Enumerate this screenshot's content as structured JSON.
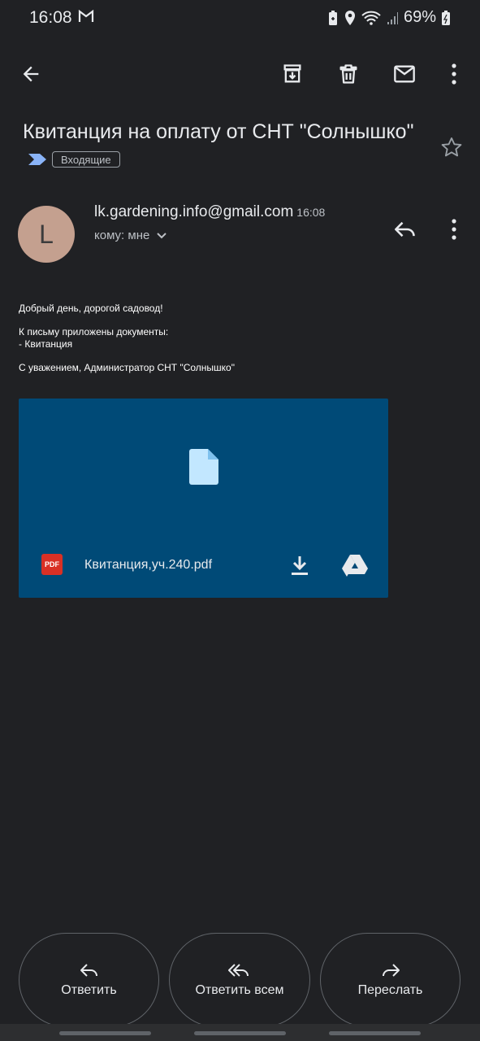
{
  "status_bar": {
    "time": "16:08",
    "battery": "69%",
    "icons": [
      "gmail-icon",
      "battery-saver-icon",
      "location-icon",
      "wifi-icon",
      "signal-icon",
      "battery-icon"
    ]
  },
  "toolbar": {
    "icons": [
      "back-arrow-icon",
      "archive-icon",
      "delete-icon",
      "mark-unread-icon",
      "more-vert-icon"
    ]
  },
  "email": {
    "subject": "Квитанция на оплату от СНТ \"Солнышко\"",
    "label": "Входящие",
    "sender_initial": "L",
    "sender": "lk.gardening.info@gmail.com",
    "time": "16:08",
    "recipients": "кому: мне",
    "body": {
      "greeting": "Добрый день, дорогой садовод!",
      "line1": "К письму приложены документы:",
      "line2": "- Квитанция",
      "signature": "С уважением, Администратор СНТ \"Солнышко\""
    }
  },
  "attachment": {
    "filename": "Квитанция,уч.240.pdf",
    "type_badge": "PDF"
  },
  "actions": {
    "reply": "Ответить",
    "reply_all": "Ответить всем",
    "forward": "Переслать"
  },
  "colors": {
    "background": "#202124",
    "attachment_bg": "#004a77",
    "avatar_bg": "#c4a08f",
    "label_arrow": "#8ab4f8"
  }
}
